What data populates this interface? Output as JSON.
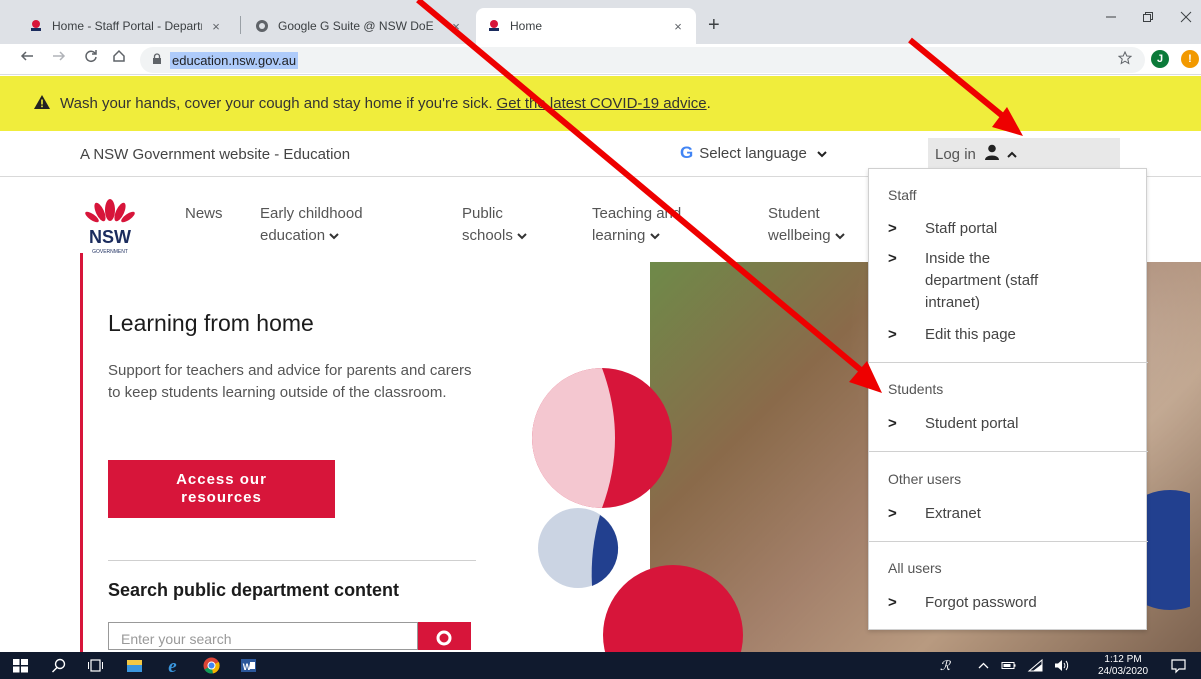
{
  "browser": {
    "tabs": [
      {
        "title": "Home - Staff Portal - Departmen",
        "active": false
      },
      {
        "title": "Google G Suite @ NSW DoE",
        "active": false
      },
      {
        "title": "Home",
        "active": true
      }
    ],
    "new_tab": "+",
    "close_glyph": "×",
    "url": "education.nsw.gov.au",
    "profile_initial": "J"
  },
  "banner": {
    "text": "Wash your hands, cover your cough and stay home if you're sick.",
    "link": "Get the latest COVID-19 advice",
    "end": "."
  },
  "govbar": {
    "text": "A NSW Government website - Education",
    "language_label": "Select language",
    "login_label": "Log in"
  },
  "logo": {
    "text": "NSW",
    "sub": "GOVERNMENT"
  },
  "nav": {
    "news": "News",
    "early_1": "Early childhood",
    "early_2": "education",
    "public_1": "Public",
    "public_2": "schools",
    "teaching_1": "Teaching and",
    "teaching_2": "learning",
    "student_1": "Student",
    "student_2": "wellbeing"
  },
  "hero": {
    "title": "Learning from home",
    "description": "Support for teachers and advice for parents and carers to keep students learning outside of the classroom.",
    "button_1": "Access our",
    "button_2": "resources",
    "search_title": "Search public department content",
    "search_placeholder": "Enter your search"
  },
  "dropdown": {
    "staff_heading": "Staff",
    "staff_portal": "Staff portal",
    "inside_department": "Inside the department (staff intranet)",
    "edit_page": "Edit this page",
    "students_heading": "Students",
    "student_portal": "Student portal",
    "other_heading": "Other users",
    "extranet": "Extranet",
    "all_heading": "All users",
    "forgot_password": "Forgot password"
  },
  "taskbar": {
    "time": "1:12 PM",
    "date": "24/03/2020"
  },
  "colors": {
    "brand_red": "#d7153a",
    "banner_yellow": "#f0ed3c",
    "annotation_arrow": "#ee0000",
    "navy": "#22408f"
  }
}
